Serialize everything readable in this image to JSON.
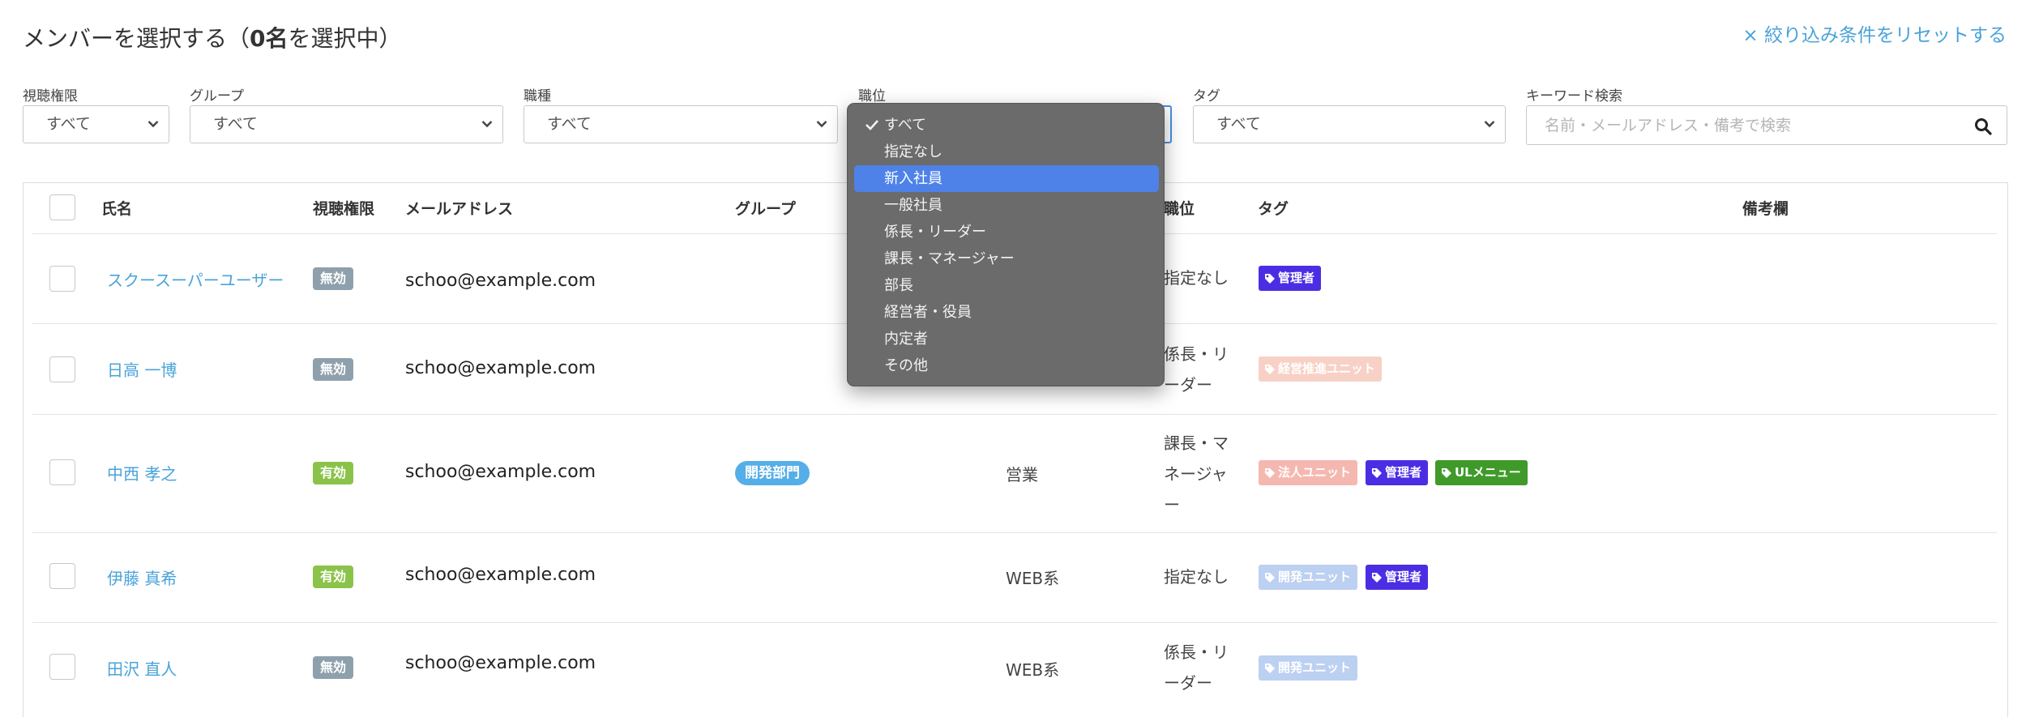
{
  "header": {
    "title_before": "メンバーを選択する（",
    "title_count": "0名",
    "title_after": "を選択中）",
    "reset_link": "× 絞り込み条件をリセットする"
  },
  "filters": {
    "viewing": {
      "label": "視聴権限",
      "value": "すべて"
    },
    "group": {
      "label": "グループ",
      "value": "すべて"
    },
    "job_type": {
      "label": "職種",
      "value": "すべて"
    },
    "position": {
      "label": "職位"
    },
    "tag": {
      "label": "タグ",
      "value": "すべて"
    },
    "keyword": {
      "label": "キーワード検索",
      "placeholder": "名前・メールアドレス・備考で検索"
    }
  },
  "table": {
    "headers": {
      "name": "氏名",
      "viewing": "視聴権限",
      "email": "メールアドレス",
      "group": "グループ",
      "position": "職位",
      "tag": "タグ",
      "note": "備考欄"
    },
    "rows": [
      {
        "name": "スクースーパーユーザー",
        "viewing": "無効",
        "email": "schoo@example.com",
        "group": "",
        "job": "",
        "position": [
          "指定なし"
        ],
        "tags": [
          "管理者"
        ]
      },
      {
        "name": "日高 一博",
        "viewing": "無効",
        "email": "schoo@example.com",
        "group": "",
        "job": "",
        "position": [
          "係長・リ",
          "ーダー"
        ],
        "tags": [
          "経営推進ユニット"
        ]
      },
      {
        "name": "中西 孝之",
        "viewing": "有効",
        "email": "schoo@example.com",
        "group": "開発部門",
        "job": "営業",
        "position": [
          "課長・マ",
          "ネージャ",
          "ー"
        ],
        "tags": [
          "法人ユニット",
          "管理者",
          "ULメニュー"
        ]
      },
      {
        "name": "伊藤 真希",
        "viewing": "有効",
        "email": "schoo@example.com",
        "group": "",
        "job": "WEB系",
        "position": [
          "指定なし"
        ],
        "tags": [
          "開発ユニット",
          "管理者"
        ]
      },
      {
        "name": "田沢 直人",
        "viewing": "無効",
        "email": "schoo@example.com",
        "group": "",
        "job": "WEB系",
        "position": [
          "係長・リ",
          "ーダー"
        ],
        "tags": [
          "開発ユニット"
        ]
      }
    ]
  },
  "position_dropdown": {
    "options": [
      "すべて",
      "指定なし",
      "新入社員",
      "一般社員",
      "係長・リーダー",
      "課長・マネージャー",
      "部長",
      "経営者・役員",
      "内定者",
      "その他"
    ],
    "checked": "すべて",
    "highlighted": "新入社員"
  },
  "colors": {
    "link": "#4aa3d9",
    "badge_disabled": "#8fa0ad",
    "badge_enabled": "#8bc34a",
    "tag_admin": "#4b2ee3",
    "tag_ul": "#3f9a2a",
    "dropdown_bg": "#6b6b6b",
    "dropdown_highlight": "#4e82e8"
  },
  "icons": {
    "search": "search-icon",
    "chevron": "chevron-down-icon",
    "tag": "tag-icon",
    "check": "checkmark-icon"
  }
}
